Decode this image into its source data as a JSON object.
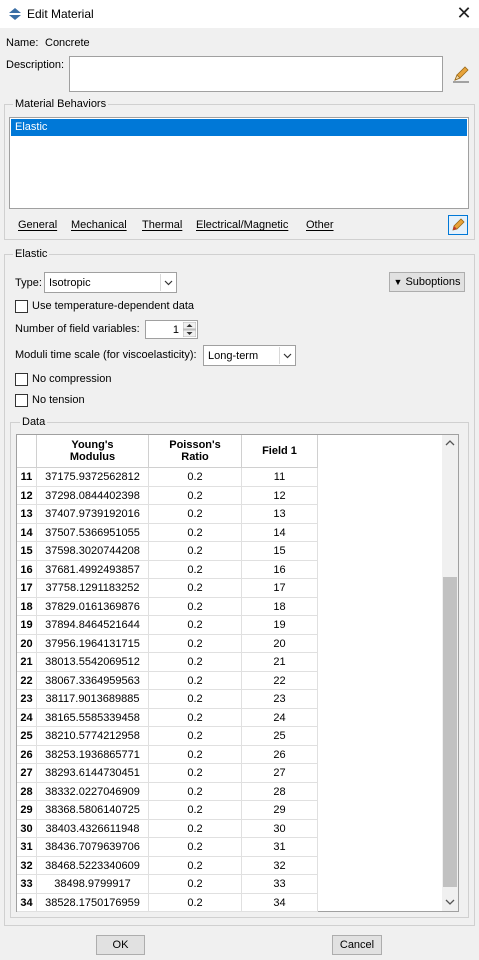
{
  "window": {
    "title": "Edit Material"
  },
  "header": {
    "name_label": "Name:",
    "name_value": "Concrete",
    "description_label": "Description:",
    "description_value": ""
  },
  "material_behaviors": {
    "title": "Material Behaviors",
    "items": [
      "Elastic"
    ],
    "selected_index": 0,
    "menu": [
      "General",
      "Mechanical",
      "Thermal",
      "Electrical/Magnetic",
      "Other"
    ]
  },
  "elastic": {
    "title": "Elastic",
    "type_label": "Type:",
    "type_value": "Isotropic",
    "suboptions_label": "Suboptions",
    "temp_dependent_label": "Use temperature-dependent data",
    "temp_dependent_checked": false,
    "field_vars_label": "Number of field variables:",
    "field_vars_value": "1",
    "moduli_label": "Moduli time scale (for viscoelasticity):",
    "moduli_value": "Long-term",
    "no_compression_label": "No compression",
    "no_compression_checked": false,
    "no_tension_label": "No tension",
    "no_tension_checked": false
  },
  "data_table": {
    "title": "Data",
    "columns": [
      "Young's Modulus",
      "Poisson's Ratio",
      "Field 1"
    ],
    "rows": [
      [
        "11",
        "37175.9372562812",
        "0.2",
        "11"
      ],
      [
        "12",
        "37298.0844402398",
        "0.2",
        "12"
      ],
      [
        "13",
        "37407.9739192016",
        "0.2",
        "13"
      ],
      [
        "14",
        "37507.5366951055",
        "0.2",
        "14"
      ],
      [
        "15",
        "37598.3020744208",
        "0.2",
        "15"
      ],
      [
        "16",
        "37681.4992493857",
        "0.2",
        "16"
      ],
      [
        "17",
        "37758.1291183252",
        "0.2",
        "17"
      ],
      [
        "18",
        "37829.0161369876",
        "0.2",
        "18"
      ],
      [
        "19",
        "37894.8464521644",
        "0.2",
        "19"
      ],
      [
        "20",
        "37956.1964131715",
        "0.2",
        "20"
      ],
      [
        "21",
        "38013.5542069512",
        "0.2",
        "21"
      ],
      [
        "22",
        "38067.3364959563",
        "0.2",
        "22"
      ],
      [
        "23",
        "38117.9013689885",
        "0.2",
        "23"
      ],
      [
        "24",
        "38165.5585339458",
        "0.2",
        "24"
      ],
      [
        "25",
        "38210.5774212958",
        "0.2",
        "25"
      ],
      [
        "26",
        "38253.1936865771",
        "0.2",
        "26"
      ],
      [
        "27",
        "38293.6144730451",
        "0.2",
        "27"
      ],
      [
        "28",
        "38332.0227046909",
        "0.2",
        "28"
      ],
      [
        "29",
        "38368.5806140725",
        "0.2",
        "29"
      ],
      [
        "30",
        "38403.4326611948",
        "0.2",
        "30"
      ],
      [
        "31",
        "38436.7079639706",
        "0.2",
        "31"
      ],
      [
        "32",
        "38468.5223340609",
        "0.2",
        "32"
      ],
      [
        "33",
        "38498.9799917",
        "0.2",
        "33"
      ],
      [
        "34",
        "38528.1750176959",
        "0.2",
        "34"
      ]
    ]
  },
  "buttons": {
    "ok": "OK",
    "cancel": "Cancel"
  },
  "icons": {
    "title": "abaqus-material-icon",
    "close": "close-icon",
    "description_edit": "pencil-icon",
    "behavior_edit": "edit-icon",
    "dropdown": "chevron-down-icon",
    "suboptions": "triangle-down-icon"
  },
  "colors": {
    "selection": "#0078d7",
    "window_bg": "#f0f0f0"
  }
}
